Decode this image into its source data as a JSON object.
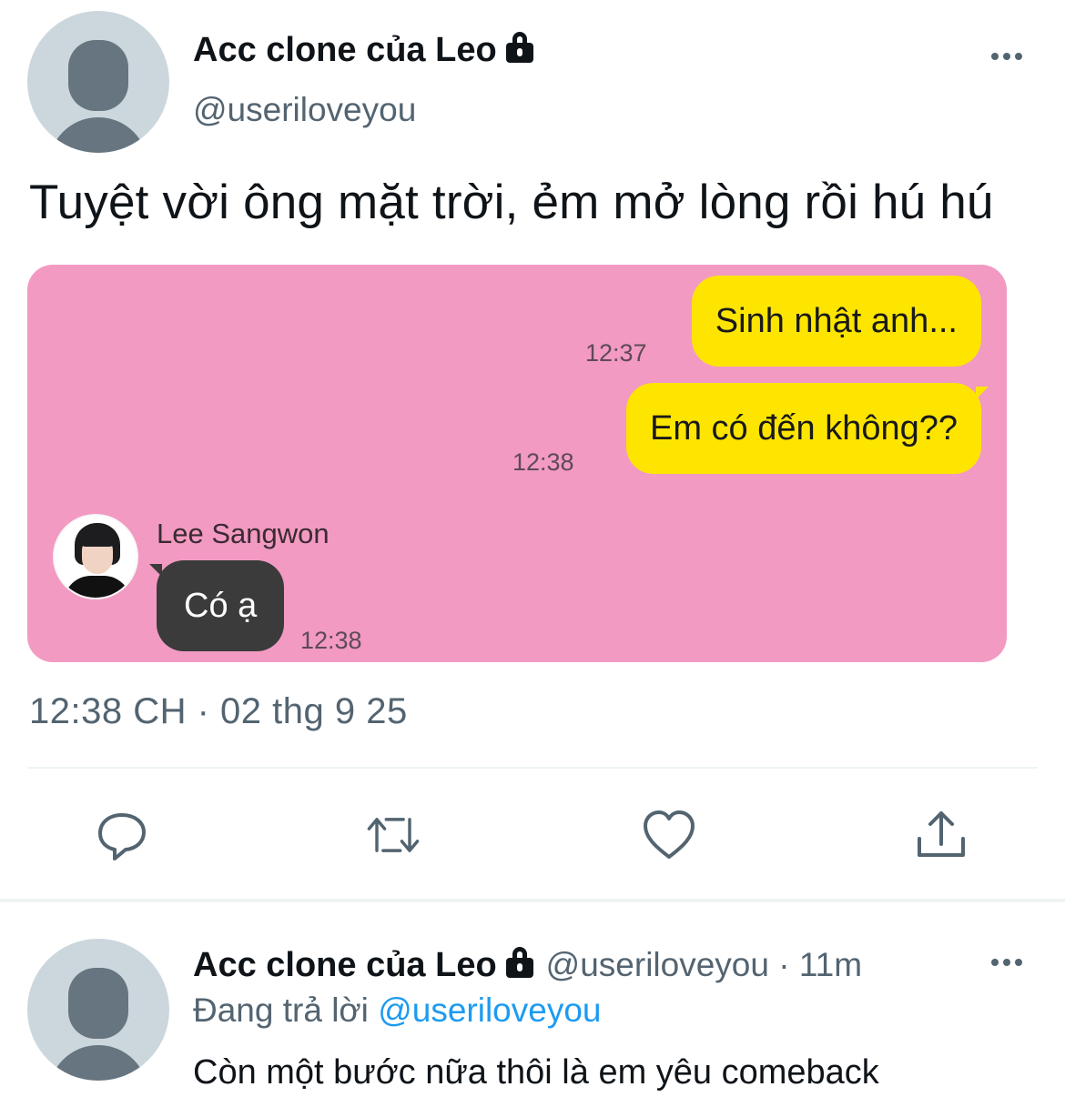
{
  "tweet": {
    "display_name": "Acc clone của Leo",
    "handle": "@useriloveyou",
    "text": "Tuyệt vời ông mặt trời, ẻm mở lòng rồi hú hú",
    "meta": "12:38 CH · 02 thg 9 25",
    "avatar_icon": "default-avatar-icon",
    "lock_icon": "lock-icon",
    "more_icon": "more-icon"
  },
  "chat_image": {
    "background_color": "#f29ac2",
    "messages": [
      {
        "text": "Sinh nhật anh...",
        "time": "12:37",
        "side": "right"
      },
      {
        "text": "Em có đến không??",
        "time": "12:38",
        "side": "right"
      },
      {
        "sender": "Lee Sangwon",
        "text": "Có ạ",
        "time": "12:38",
        "side": "left"
      }
    ]
  },
  "actions": [
    {
      "name": "reply",
      "icon": "reply-icon"
    },
    {
      "name": "retweet",
      "icon": "retweet-icon"
    },
    {
      "name": "like",
      "icon": "heart-icon"
    },
    {
      "name": "share",
      "icon": "share-icon"
    }
  ],
  "reply": {
    "display_name": "Acc clone của Leo",
    "handle_time": "@useriloveyou · 11m",
    "replying_prefix": "Đang trả lời",
    "replying_handle": "@useriloveyou",
    "text": "Còn một bước nữa thôi là em yêu comeback"
  },
  "colors": {
    "accent": "#1d9bf0",
    "secondary_text": "#536471",
    "bubble_yellow": "#fee500",
    "bubble_dark": "#3b3b3b"
  }
}
